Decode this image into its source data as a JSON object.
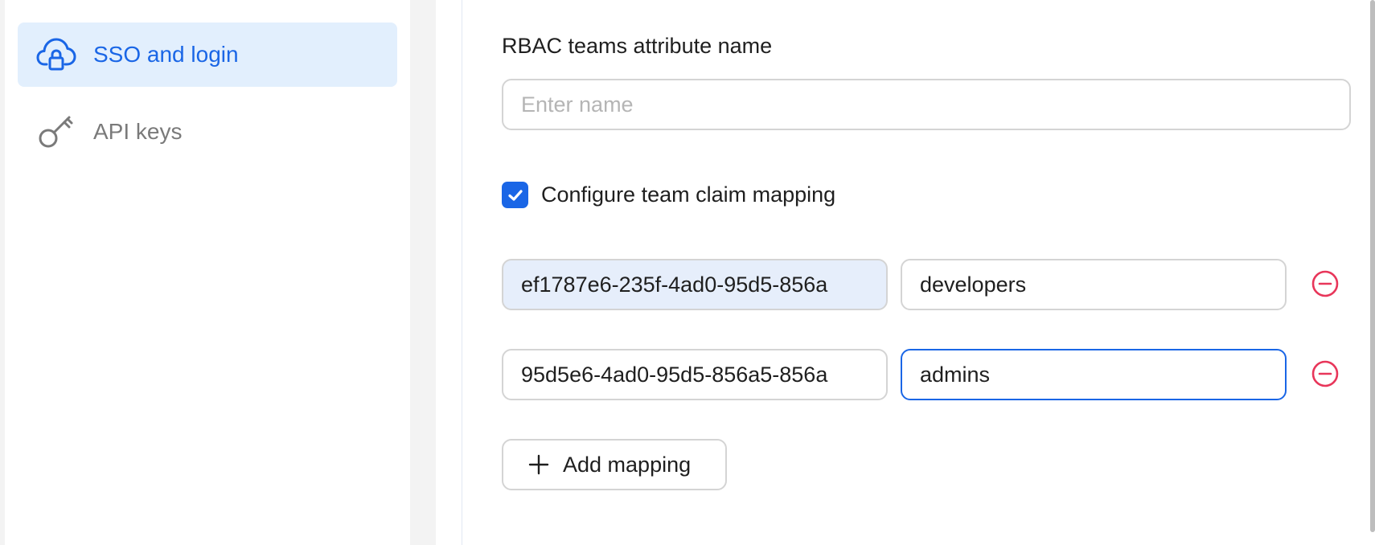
{
  "sidebar": {
    "items": [
      {
        "label": "SSO and login",
        "icon": "cloud-lock-icon",
        "active": true
      },
      {
        "label": "API keys",
        "icon": "key-icon",
        "active": false
      }
    ]
  },
  "form": {
    "rbac_label": "RBAC teams attribute name",
    "rbac_input": {
      "value": "",
      "placeholder": "Enter name"
    },
    "team_mapping_checkbox": {
      "label": "Configure team claim mapping",
      "checked": true
    },
    "mappings": [
      {
        "claim": "ef1787e6-235f-4ad0-95d5-856a",
        "team": "developers"
      },
      {
        "claim": "95d5e6-4ad0-95d5-856a5-856a",
        "team": "admins"
      }
    ],
    "add_mapping_label": "Add mapping"
  },
  "colors": {
    "accent": "#1a66e6",
    "active_bg": "#e2effd",
    "remove": "#e8365a",
    "filled_input_bg": "#e6eefb"
  }
}
